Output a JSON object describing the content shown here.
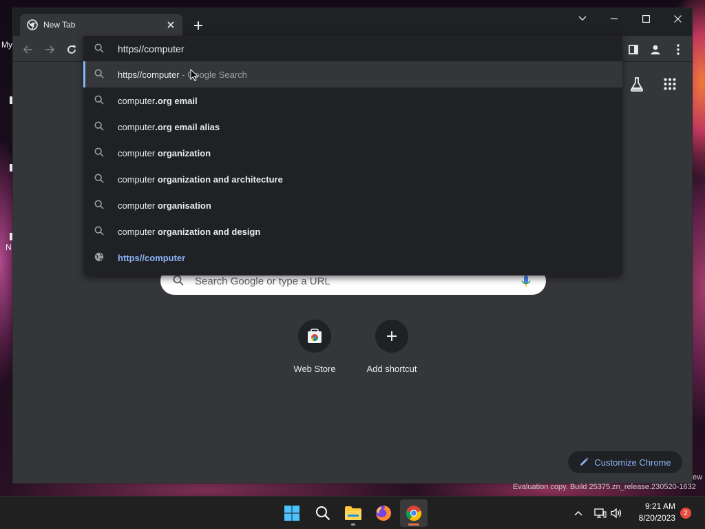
{
  "desktop": {
    "label_top": "My",
    "label_mid": "N",
    "watermark": "Evaluation copy. Build 25375.zn_release.230520-1632",
    "watermark_edge": "ew"
  },
  "browser": {
    "tab_title": "New Tab",
    "omnibox": {
      "input_value": "https//computer",
      "suggestions": [
        {
          "icon": "search-icon",
          "plain": "https//computer",
          "bold": "",
          "hint": " - Google Search",
          "selected": true
        },
        {
          "icon": "search-icon",
          "plain": "computer",
          "bold": ".org email",
          "hint": ""
        },
        {
          "icon": "search-icon",
          "plain": "computer",
          "bold": ".org email alias",
          "hint": ""
        },
        {
          "icon": "search-icon",
          "plain": "computer ",
          "bold": "organization",
          "hint": ""
        },
        {
          "icon": "search-icon",
          "plain": "computer ",
          "bold": "organization and architecture",
          "hint": ""
        },
        {
          "icon": "search-icon",
          "plain": "computer ",
          "bold": "organisation",
          "hint": ""
        },
        {
          "icon": "search-icon",
          "plain": "computer ",
          "bold": "organization and design",
          "hint": ""
        },
        {
          "icon": "globe-icon",
          "link": "https//computer"
        }
      ]
    },
    "ntp": {
      "search_placeholder": "Search Google or type a URL",
      "shortcuts": [
        {
          "label": "Web Store",
          "icon": "web-store-icon"
        },
        {
          "label": "Add shortcut",
          "icon": "plus-icon"
        }
      ],
      "customize_label": "Customize Chrome"
    }
  },
  "taskbar": {
    "time": "9:21 AM",
    "date": "8/20/2023",
    "notification_count": "2",
    "apps": [
      "windows-start-icon",
      "search-icon",
      "file-explorer-icon",
      "firefox-icon",
      "chrome-icon"
    ]
  },
  "colors": {
    "accent": "#8ab4f8",
    "dropdown_bg": "#202124",
    "window_bg": "#35363a"
  }
}
